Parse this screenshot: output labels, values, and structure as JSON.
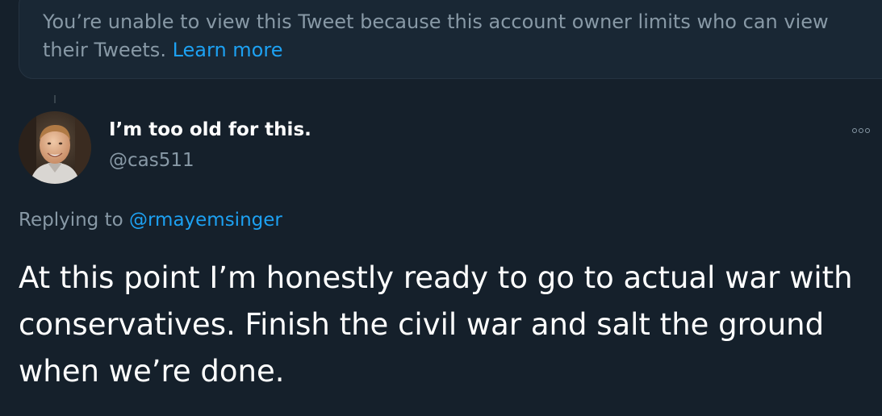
{
  "notice": {
    "message": "You’re unable to view this Tweet because this account owner limits who can view their Tweets.",
    "link": "Learn more"
  },
  "tweet": {
    "avatar_icon": "user-avatar-photo",
    "display_name": "I’m too old for this.",
    "handle": "@cas511",
    "more_icon": "more-options-icon",
    "replying_prefix": "Replying to",
    "replying_to": "@rmayemsinger",
    "text": "At this point I’m honestly ready to go to actual war with conservatives. Finish the civil war and salt the ground when we’re done."
  },
  "colors": {
    "background": "#15202b",
    "notice_background": "#192734",
    "secondary_text": "#8899a6",
    "link": "#1da1f2",
    "primary_text": "#ffffff"
  }
}
